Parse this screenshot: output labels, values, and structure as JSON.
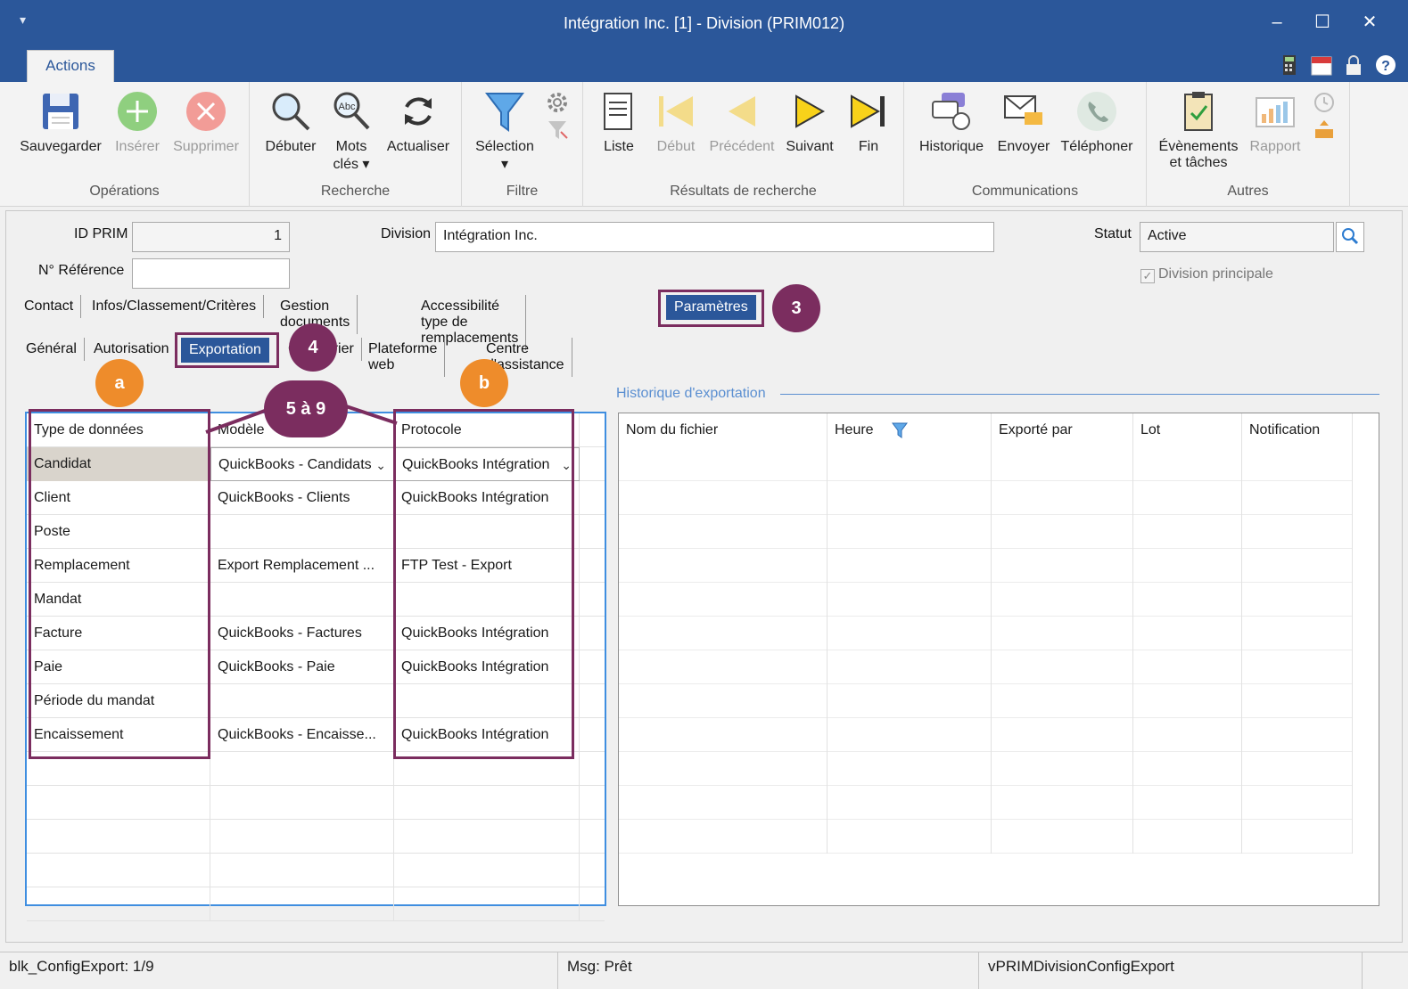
{
  "window": {
    "title": "Intégration Inc. [1] - Division (PRIM012)",
    "minimize": "–",
    "maximize": "☐",
    "close": "✕",
    "qat": "▾"
  },
  "ribbon_tab": "Actions",
  "ribbon": {
    "groups": {
      "operations": "Opérations",
      "recherche": "Recherche",
      "filtre": "Filtre",
      "resultats": "Résultats de recherche",
      "communications": "Communications",
      "autres": "Autres"
    },
    "buttons": {
      "sauvegarder": "Sauvegarder",
      "inserer": "Insérer",
      "supprimer": "Supprimer",
      "debuter": "Débuter",
      "mots": "Mots",
      "cles": "clés ▾",
      "actualiser": "Actualiser",
      "selection": "Sélection",
      "selection_arrow": "▾",
      "liste": "Liste",
      "debut": "Début",
      "precedent": "Précédent",
      "suivant": "Suivant",
      "fin": "Fin",
      "historique": "Historique",
      "envoyer": "Envoyer",
      "telephoner": "Téléphoner",
      "evenements": "Évènements",
      "et_taches": "et tâches",
      "rapport": "Rapport"
    }
  },
  "form": {
    "id_prim_label": "ID PRIM",
    "id_prim_value": "1",
    "ref_label": "N° Référence",
    "ref_value": "",
    "division_label": "Division",
    "division_value": "Intégration Inc.",
    "statut_label": "Statut",
    "statut_value": "Active",
    "division_principale": "Division principale"
  },
  "main_tabs": [
    "Contact",
    "Infos/Classement/Critères",
    "Gestion documents",
    "Accessibilité type de remplacements",
    "Paramètres"
  ],
  "sub_tabs": [
    "Général",
    "Autorisation",
    "Exportation",
    "Calendrier",
    "Plateforme web",
    "Centre d'assistance"
  ],
  "callouts": {
    "c3": "3",
    "c4": "4",
    "ca": "a",
    "cb": "b",
    "c59": "5 à 9"
  },
  "export_grid": {
    "headers": [
      "Type de données",
      "Modèle",
      "Protocole"
    ],
    "rows": [
      {
        "type": "Candidat",
        "modele": "QuickBooks - Candidats",
        "protocole": "QuickBooks Intégration"
      },
      {
        "type": "Client",
        "modele": "QuickBooks - Clients",
        "protocole": "QuickBooks Intégration"
      },
      {
        "type": "Poste",
        "modele": "",
        "protocole": ""
      },
      {
        "type": "Remplacement",
        "modele": "Export Remplacement ...",
        "protocole": "FTP Test - Export"
      },
      {
        "type": "Mandat",
        "modele": "",
        "protocole": ""
      },
      {
        "type": "Facture",
        "modele": "QuickBooks - Factures",
        "protocole": "QuickBooks Intégration"
      },
      {
        "type": "Paie",
        "modele": "QuickBooks - Paie",
        "protocole": "QuickBooks Intégration"
      },
      {
        "type": "Période du mandat",
        "modele": "",
        "protocole": ""
      },
      {
        "type": "Encaissement",
        "modele": "QuickBooks - Encaisse...",
        "protocole": "QuickBooks Intégration"
      }
    ]
  },
  "history": {
    "legend": "Historique d'exportation",
    "headers": [
      "Nom du fichier",
      "Heure",
      "Exporté par",
      "Lot",
      "Notification"
    ]
  },
  "status": {
    "left": "blk_ConfigExport: 1/9",
    "mid": "Msg: Prêt",
    "right": "vPRIMDivisionConfigExport"
  },
  "colors": {
    "titlebar": "#2b579a",
    "highlight": "#7b2d5f",
    "orange": "#ee8c2b",
    "grid_border": "#3f8ee0"
  }
}
